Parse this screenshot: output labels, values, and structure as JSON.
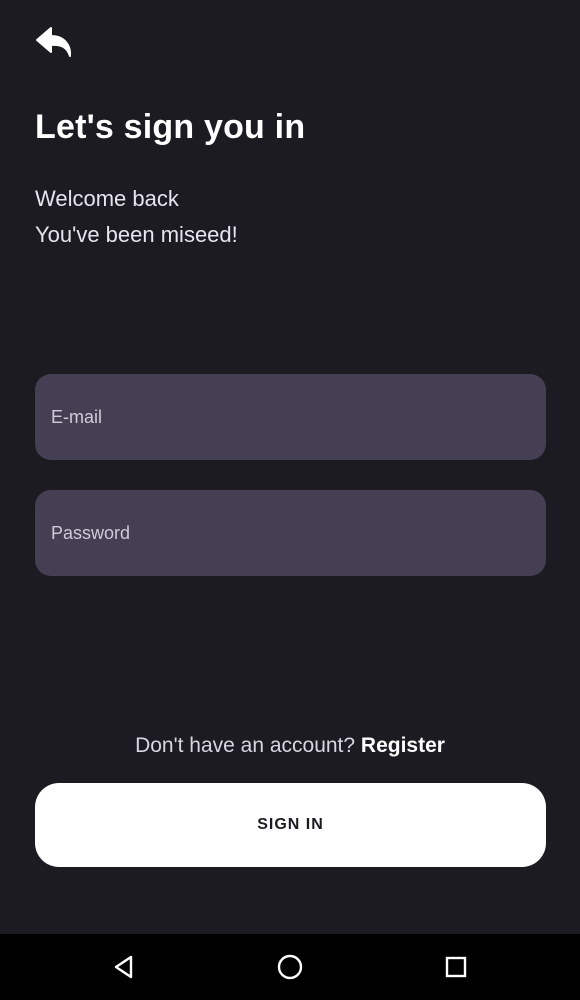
{
  "header": {
    "back_icon": "back-arrow-icon",
    "title": "Let's sign you in",
    "subtitle_line1": "Welcome back",
    "subtitle_line2": "You've been miseed!"
  },
  "form": {
    "email_placeholder": "E-mail",
    "email_value": "",
    "password_placeholder": "Password",
    "password_value": ""
  },
  "register": {
    "prompt": "Don't have an account?",
    "link_label": "Register"
  },
  "actions": {
    "signin_label": "SIGN IN"
  },
  "nav_bar": {
    "back_icon": "triangle-back-icon",
    "home_icon": "circle-home-icon",
    "recents_icon": "square-recents-icon"
  },
  "colors": {
    "background": "#1c1b22",
    "input_background": "#443f52",
    "button_background": "#ffffff",
    "nav_background": "#000000"
  }
}
